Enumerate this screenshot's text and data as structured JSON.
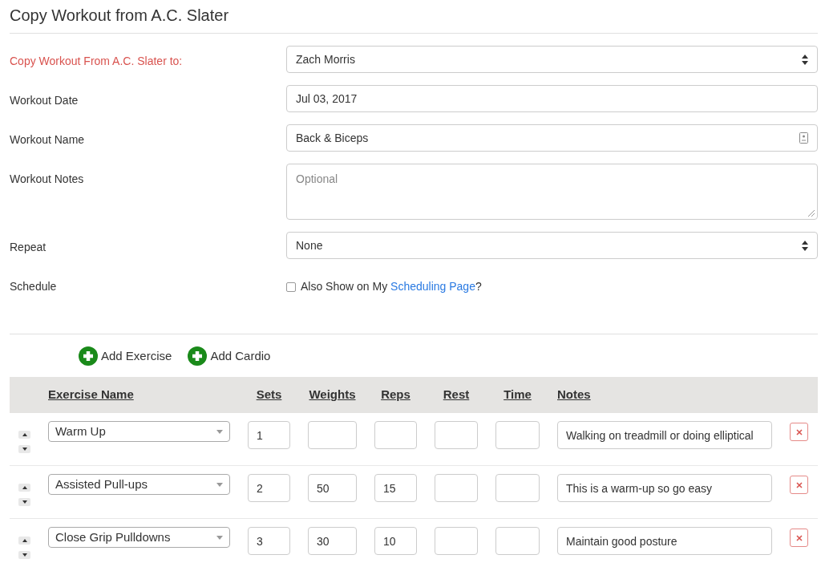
{
  "title": "Copy Workout from A.C. Slater",
  "form": [
    {
      "kind": "select",
      "label": "Copy Workout From A.C. Slater to:",
      "color": "#d9534f",
      "value": "Zach Morris",
      "autofill_icon": false
    },
    {
      "kind": "text",
      "label": "Workout Date",
      "color": "#333333",
      "value": "Jul 03, 2017",
      "autofill_icon": false
    },
    {
      "kind": "text",
      "label": "Workout Name",
      "color": "#333333",
      "value": "Back & Biceps",
      "autofill_icon": true
    },
    {
      "kind": "textarea",
      "label": "Workout Notes",
      "color": "#333333",
      "placeholder": "Optional",
      "autofill_icon": false
    },
    {
      "kind": "select",
      "label": "Repeat",
      "color": "#333333",
      "value": "None",
      "autofill_icon": false
    },
    {
      "kind": "checkbox",
      "label": "Schedule",
      "color": "#333333",
      "checked": false,
      "text": "Also Show on My",
      "link": "Scheduling Page",
      "suffix": "?",
      "autofill_icon": false
    }
  ],
  "actions": [
    {
      "label": "Add Exercise"
    },
    {
      "label": "Add Cardio"
    }
  ],
  "table": {
    "columns": [
      "Exercise Name",
      "Sets",
      "Weights",
      "Reps",
      "Rest",
      "Time",
      "Notes"
    ],
    "rows": [
      {
        "exercise": "Warm Up",
        "sets": "1",
        "notes": "Walking on treadmill or doing elliptical"
      },
      {
        "exercise": "Assisted Pull-ups",
        "sets": "2",
        "weights": "50",
        "reps": "15",
        "notes": "This is a warm-up so go easy"
      },
      {
        "exercise": "Close Grip Pulldowns",
        "sets": "3",
        "weights": "30",
        "reps": "10",
        "notes": "Maintain good posture"
      }
    ]
  }
}
